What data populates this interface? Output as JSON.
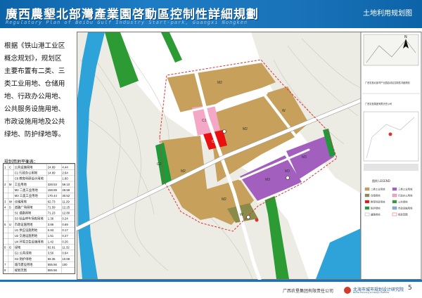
{
  "header": {
    "title": "廣西農墾北部灣產業園啓動區控制性詳細規劃",
    "subtitle": "土地利用规划图",
    "subtitle_en": "Regulatory Plan of Beibu Gulf Industry Start-park, Guangxi Nongken"
  },
  "intro": {
    "lines": [
      "根据《铁山港工业区",
      "概念规划》，规划区",
      "主要布置有二类、三",
      "类工业用地、仓储用",
      "地、行政办公用地、",
      "公共服务设施用地、",
      "市政设施用地及公共",
      "绿地、防护绿地等。"
    ]
  },
  "table": {
    "caption": "规划用地平衡表：",
    "rows": [
      [
        "1",
        "C",
        "公共设施用地",
        "24.69",
        "4.44"
      ],
      [
        "",
        "",
        "C1 行政办公用地",
        "14.69",
        "2.64"
      ],
      [
        "",
        "",
        "C6 教育科研设计用地",
        "",
        "1.80"
      ],
      [
        "2",
        "M",
        "工业用地",
        "328.53",
        "59.10"
      ],
      [
        "",
        "",
        "M2 二类工业用地",
        "158.89",
        "28.58"
      ],
      [
        "",
        "",
        "M3 三类工业用地",
        "170.44",
        "30.52"
      ],
      [
        "3",
        "W",
        "仓储用地",
        "62.73",
        "11.29"
      ],
      [
        "4",
        "S",
        "道路广场用地",
        "71.59",
        "12.25"
      ],
      [
        "",
        "",
        "S1 道路用地",
        "71.23",
        "12.80"
      ],
      [
        "",
        "",
        "S3 社会停车场库用地",
        "1.36",
        "0.24"
      ],
      [
        "5",
        "U",
        "市政设施用地",
        "3.86",
        "0.69"
      ],
      [
        "",
        "",
        "U1 供应设施用地",
        "0.93",
        "0.17"
      ],
      [
        "",
        "",
        "U2 交通设施用地",
        "1.51",
        "0.27"
      ],
      [
        "",
        "",
        "U4 环境卫生设施用地",
        "1.42",
        "0.26"
      ],
      [
        "6",
        "G",
        "绿地",
        "62.91",
        "11.32"
      ],
      [
        "",
        "",
        "G1 公共绿地",
        "3.56",
        "0.64"
      ],
      [
        "",
        "",
        "G2 防护绿地",
        "59.35",
        "10.68"
      ],
      [
        "7",
        "",
        "城市建设用地",
        "555.56",
        "100"
      ],
      [
        "8",
        "",
        "规划范围",
        "555.56",
        ""
      ]
    ]
  },
  "map": {
    "labels": [
      "M2",
      "M2",
      "M2",
      "M2",
      "M3",
      "M3",
      "M3",
      "W",
      "W",
      "C1",
      "C1",
      "G2"
    ]
  },
  "titleblock": {
    "project": "广西农垦北部湾产业园启动区控制性详细规划",
    "client": "广西农垦集团有限责任公司",
    "legend_title": "图例 LEGEND",
    "legend": [
      "二类工业用地",
      "三类工业用地",
      "仓储用地",
      "行政办公用地",
      "教育科研用地",
      "公共绿地",
      "防护绿地",
      "市政设施用地",
      "道路用地",
      "规划范围"
    ],
    "north": "N"
  },
  "footer": {
    "company": "广西农垦集团有限责任公司",
    "institute": "北海市城市规划设计研究院",
    "institute_en": "Beihai Planning & Design Institute"
  },
  "page_number": "5",
  "colors": {
    "m2": "#c7a05c",
    "m3": "#a25fbe",
    "w": "#8a8a4a",
    "c1": "#f4a8c5",
    "c6": "#e81010",
    "g1": "#2c9b34",
    "g2": "#1f9a3a",
    "brand": "#1a73b8"
  }
}
